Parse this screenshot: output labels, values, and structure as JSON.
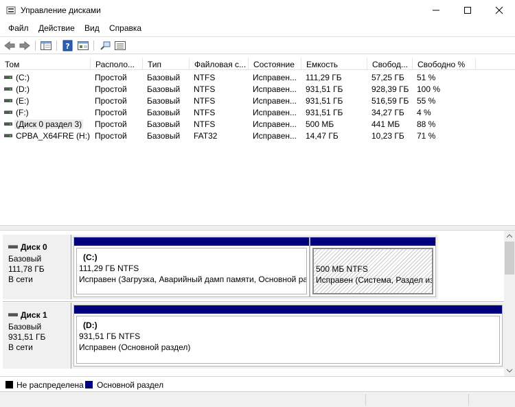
{
  "window": {
    "title": "Управление дисками"
  },
  "menu": [
    "Файл",
    "Действие",
    "Вид",
    "Справка"
  ],
  "toolbar": {
    "icons": [
      "back-arrow-icon",
      "forward-arrow-icon",
      "console-tree-icon",
      "help-icon",
      "properties-icon",
      "connect-icon",
      "view-icon"
    ]
  },
  "volumes": {
    "columns": [
      "Том",
      "Располо...",
      "Тип",
      "Файловая с...",
      "Состояние",
      "Емкость",
      "Свобод...",
      "Свободно %"
    ],
    "rows": [
      [
        "(C:)",
        "Простой",
        "Базовый",
        "NTFS",
        "Исправен...",
        "111,29 ГБ",
        "57,25 ГБ",
        "51 %"
      ],
      [
        "(D:)",
        "Простой",
        "Базовый",
        "NTFS",
        "Исправен...",
        "931,51 ГБ",
        "928,39 ГБ",
        "100 %"
      ],
      [
        "(E:)",
        "Простой",
        "Базовый",
        "NTFS",
        "Исправен...",
        "931,51 ГБ",
        "516,59 ГБ",
        "55 %"
      ],
      [
        "(F:)",
        "Простой",
        "Базовый",
        "NTFS",
        "Исправен...",
        "931,51 ГБ",
        "34,27 ГБ",
        "4 %"
      ],
      [
        "(Диск 0 раздел 3)",
        "Простой",
        "Базовый",
        "NTFS",
        "Исправен...",
        "500 МБ",
        "441 МБ",
        "88 %"
      ],
      [
        "CPBA_X64FRE (H:)",
        "Простой",
        "Базовый",
        "FAT32",
        "Исправен...",
        "14,47 ГБ",
        "10,23 ГБ",
        "71 %"
      ]
    ]
  },
  "disks": [
    {
      "name": "Диск 0",
      "type": "Базовый",
      "size": "111,78 ГБ",
      "status": "В сети",
      "partitions": [
        {
          "label": "(C:)",
          "size_fs": "111,29 ГБ NTFS",
          "status": "Исправен (Загрузка, Аварийный дамп памяти, Основной ра"
        },
        {
          "label": "",
          "size_fs": "500 МБ NTFS",
          "status": "Исправен (Система, Раздел изо"
        }
      ]
    },
    {
      "name": "Диск 1",
      "type": "Базовый",
      "size": "931,51 ГБ",
      "status": "В сети",
      "partitions": [
        {
          "label": "(D:)",
          "size_fs": "931,51 ГБ NTFS",
          "status": "Исправен (Основной раздел)"
        }
      ]
    }
  ],
  "legend": [
    {
      "label": "Не распределена",
      "color": "#000000"
    },
    {
      "label": "Основной раздел",
      "color": "#00007f"
    }
  ]
}
